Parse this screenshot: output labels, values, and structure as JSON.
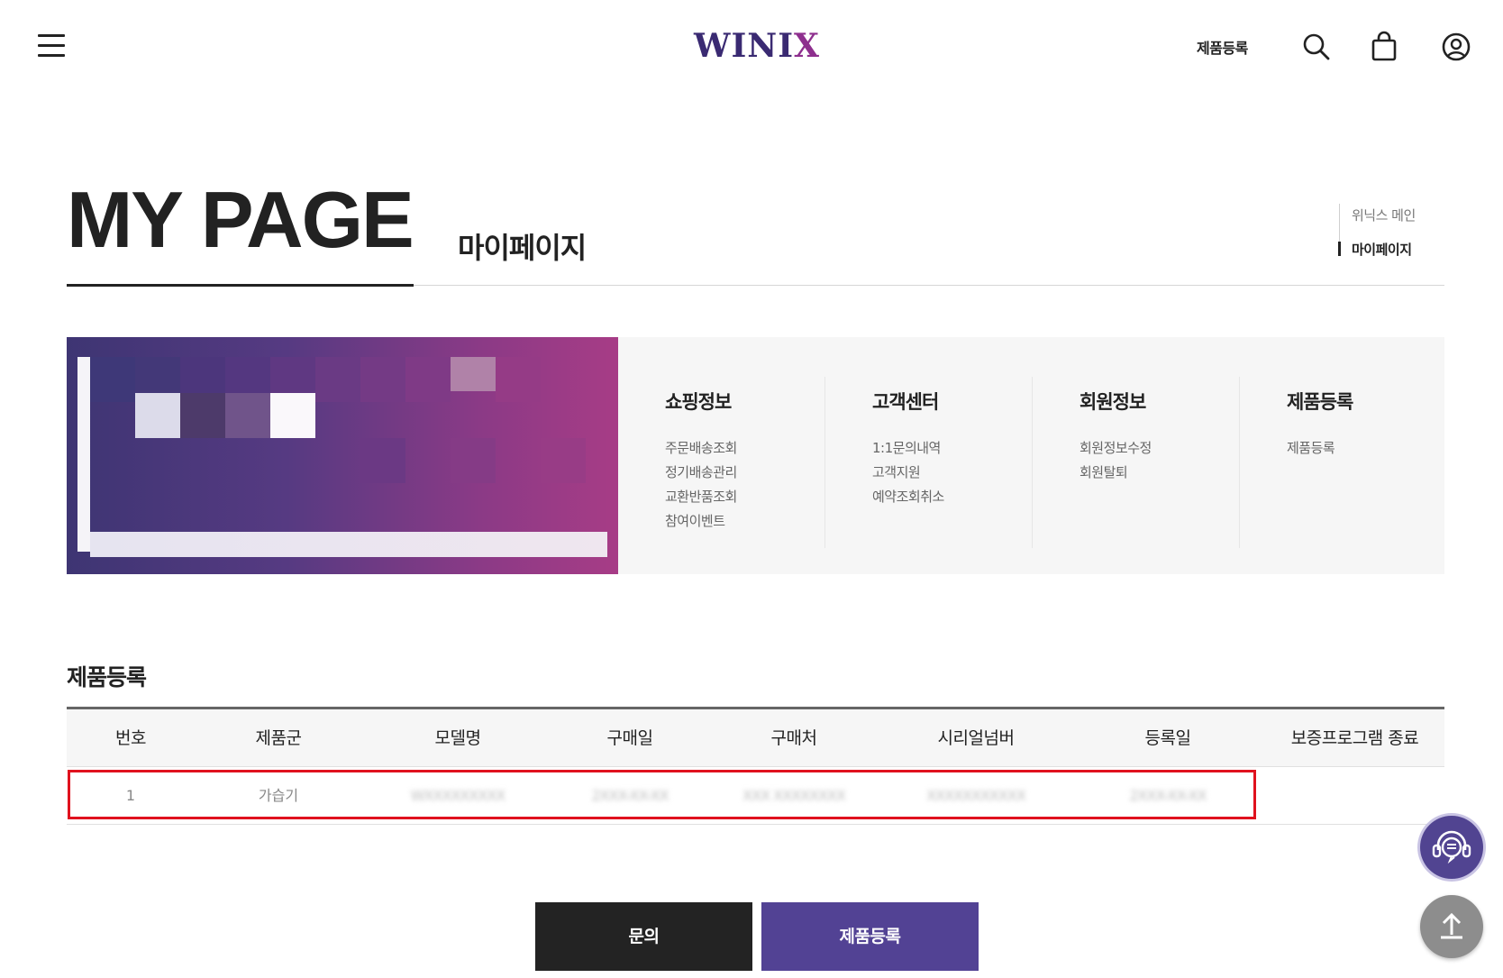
{
  "header": {
    "logo_main": "WINI",
    "logo_x": "X",
    "register_link": "제품등록",
    "icons": [
      "hamburger-menu-icon",
      "search-icon",
      "shopping-bag-icon",
      "user-account-icon"
    ]
  },
  "page": {
    "title_en": "MY PAGE",
    "title_ko": "마이페이지"
  },
  "breadcrumb": {
    "items": [
      {
        "label": "위닉스 메인",
        "active": false
      },
      {
        "label": "마이페이지",
        "active": true
      }
    ]
  },
  "menu": {
    "columns": [
      {
        "heading": "쇼핑정보",
        "items": [
          "주문배송조회",
          "정기배송관리",
          "교환반품조회",
          "참여이벤트"
        ]
      },
      {
        "heading": "고객센터",
        "items": [
          "1:1문의내역",
          "고객지원",
          "예약조회취소"
        ]
      },
      {
        "heading": "회원정보",
        "items": [
          "회원정보수정",
          "회원탈퇴"
        ]
      },
      {
        "heading": "제품등록",
        "items": [
          "제품등록"
        ]
      }
    ]
  },
  "product_registration": {
    "title": "제품등록",
    "columns": [
      "번호",
      "제품군",
      "모델명",
      "구매일",
      "구매처",
      "시리얼넘버",
      "등록일",
      "보증프로그램 종료"
    ],
    "rows": [
      {
        "no": "1",
        "category": "가습기",
        "model": "WXXXXXXXXX",
        "purchase_date": "2XXX-XX-XX",
        "store": "XXX XXXXXXXX",
        "serial": "XXXXXXXXXXX",
        "reg_date": "2XXX-XX-XX",
        "warranty_end": ""
      }
    ]
  },
  "buttons": {
    "inquiry": "문의",
    "register": "제품등록"
  },
  "floating": {
    "chat_icon": "chatbot-headset-icon",
    "top_icon": "arrow-up-icon"
  },
  "colors": {
    "brand_purple": "#524294",
    "dark_button": "#232323",
    "highlight_red": "#e0121e"
  }
}
